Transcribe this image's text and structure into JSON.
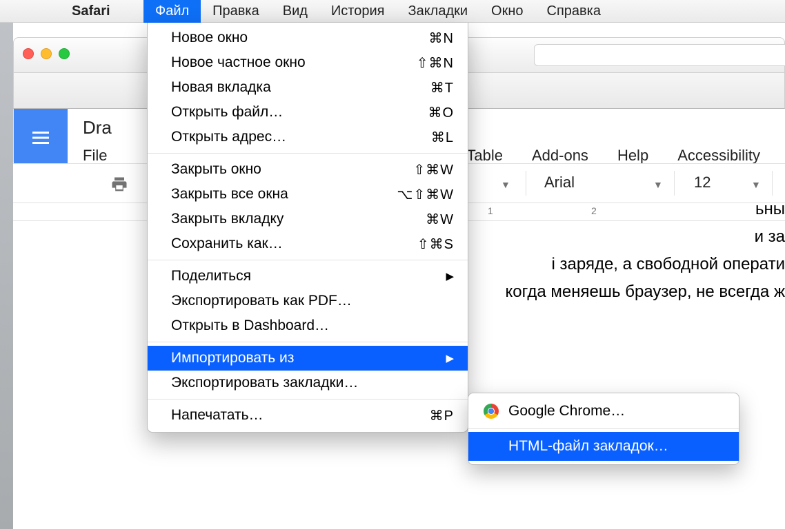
{
  "menubar": {
    "app_name": "Safari",
    "items": [
      "Файл",
      "Правка",
      "Вид",
      "История",
      "Закладки",
      "Окно",
      "Справка"
    ],
    "active_index": 0
  },
  "dropdown": {
    "groups": [
      [
        {
          "label": "Новое окно",
          "shortcut": "⌘N"
        },
        {
          "label": "Новое частное окно",
          "shortcut": "⇧⌘N"
        },
        {
          "label": "Новая вкладка",
          "shortcut": "⌘T"
        },
        {
          "label": "Открыть файл…",
          "shortcut": "⌘O"
        },
        {
          "label": "Открыть адрес…",
          "shortcut": "⌘L"
        }
      ],
      [
        {
          "label": "Закрыть окно",
          "shortcut": "⇧⌘W"
        },
        {
          "label": "Закрыть все окна",
          "shortcut": "⌥⇧⌘W"
        },
        {
          "label": "Закрыть вкладку",
          "shortcut": "⌘W"
        },
        {
          "label": "Сохранить как…",
          "shortcut": "⇧⌘S"
        }
      ],
      [
        {
          "label": "Поделиться",
          "submenu": true
        },
        {
          "label": "Экспортировать как PDF…"
        },
        {
          "label": "Открыть в Dashboard…"
        }
      ],
      [
        {
          "label": "Импортировать из",
          "submenu": true,
          "selected": true
        },
        {
          "label": "Экспортировать закладки…"
        }
      ],
      [
        {
          "label": "Напечатать…",
          "shortcut": "⌘P"
        }
      ]
    ]
  },
  "submenu": {
    "items": [
      {
        "label": "Google Chrome…",
        "icon": "chrome"
      },
      {
        "label": "HTML-файл закладок…",
        "selected": true
      }
    ]
  },
  "gdoc": {
    "title_prefix": "Dra",
    "menus_left": [
      "File"
    ],
    "menus_right": [
      "Table",
      "Add-ons",
      "Help",
      "Accessibility"
    ],
    "font": "Arial",
    "font_size": "12",
    "ruler": [
      "1",
      "2"
    ],
    "body_lines": [
      "ьны",
      "и за",
      "і заряде, а свободной операти",
      "когда меняешь браузер, не всегда ж"
    ]
  }
}
